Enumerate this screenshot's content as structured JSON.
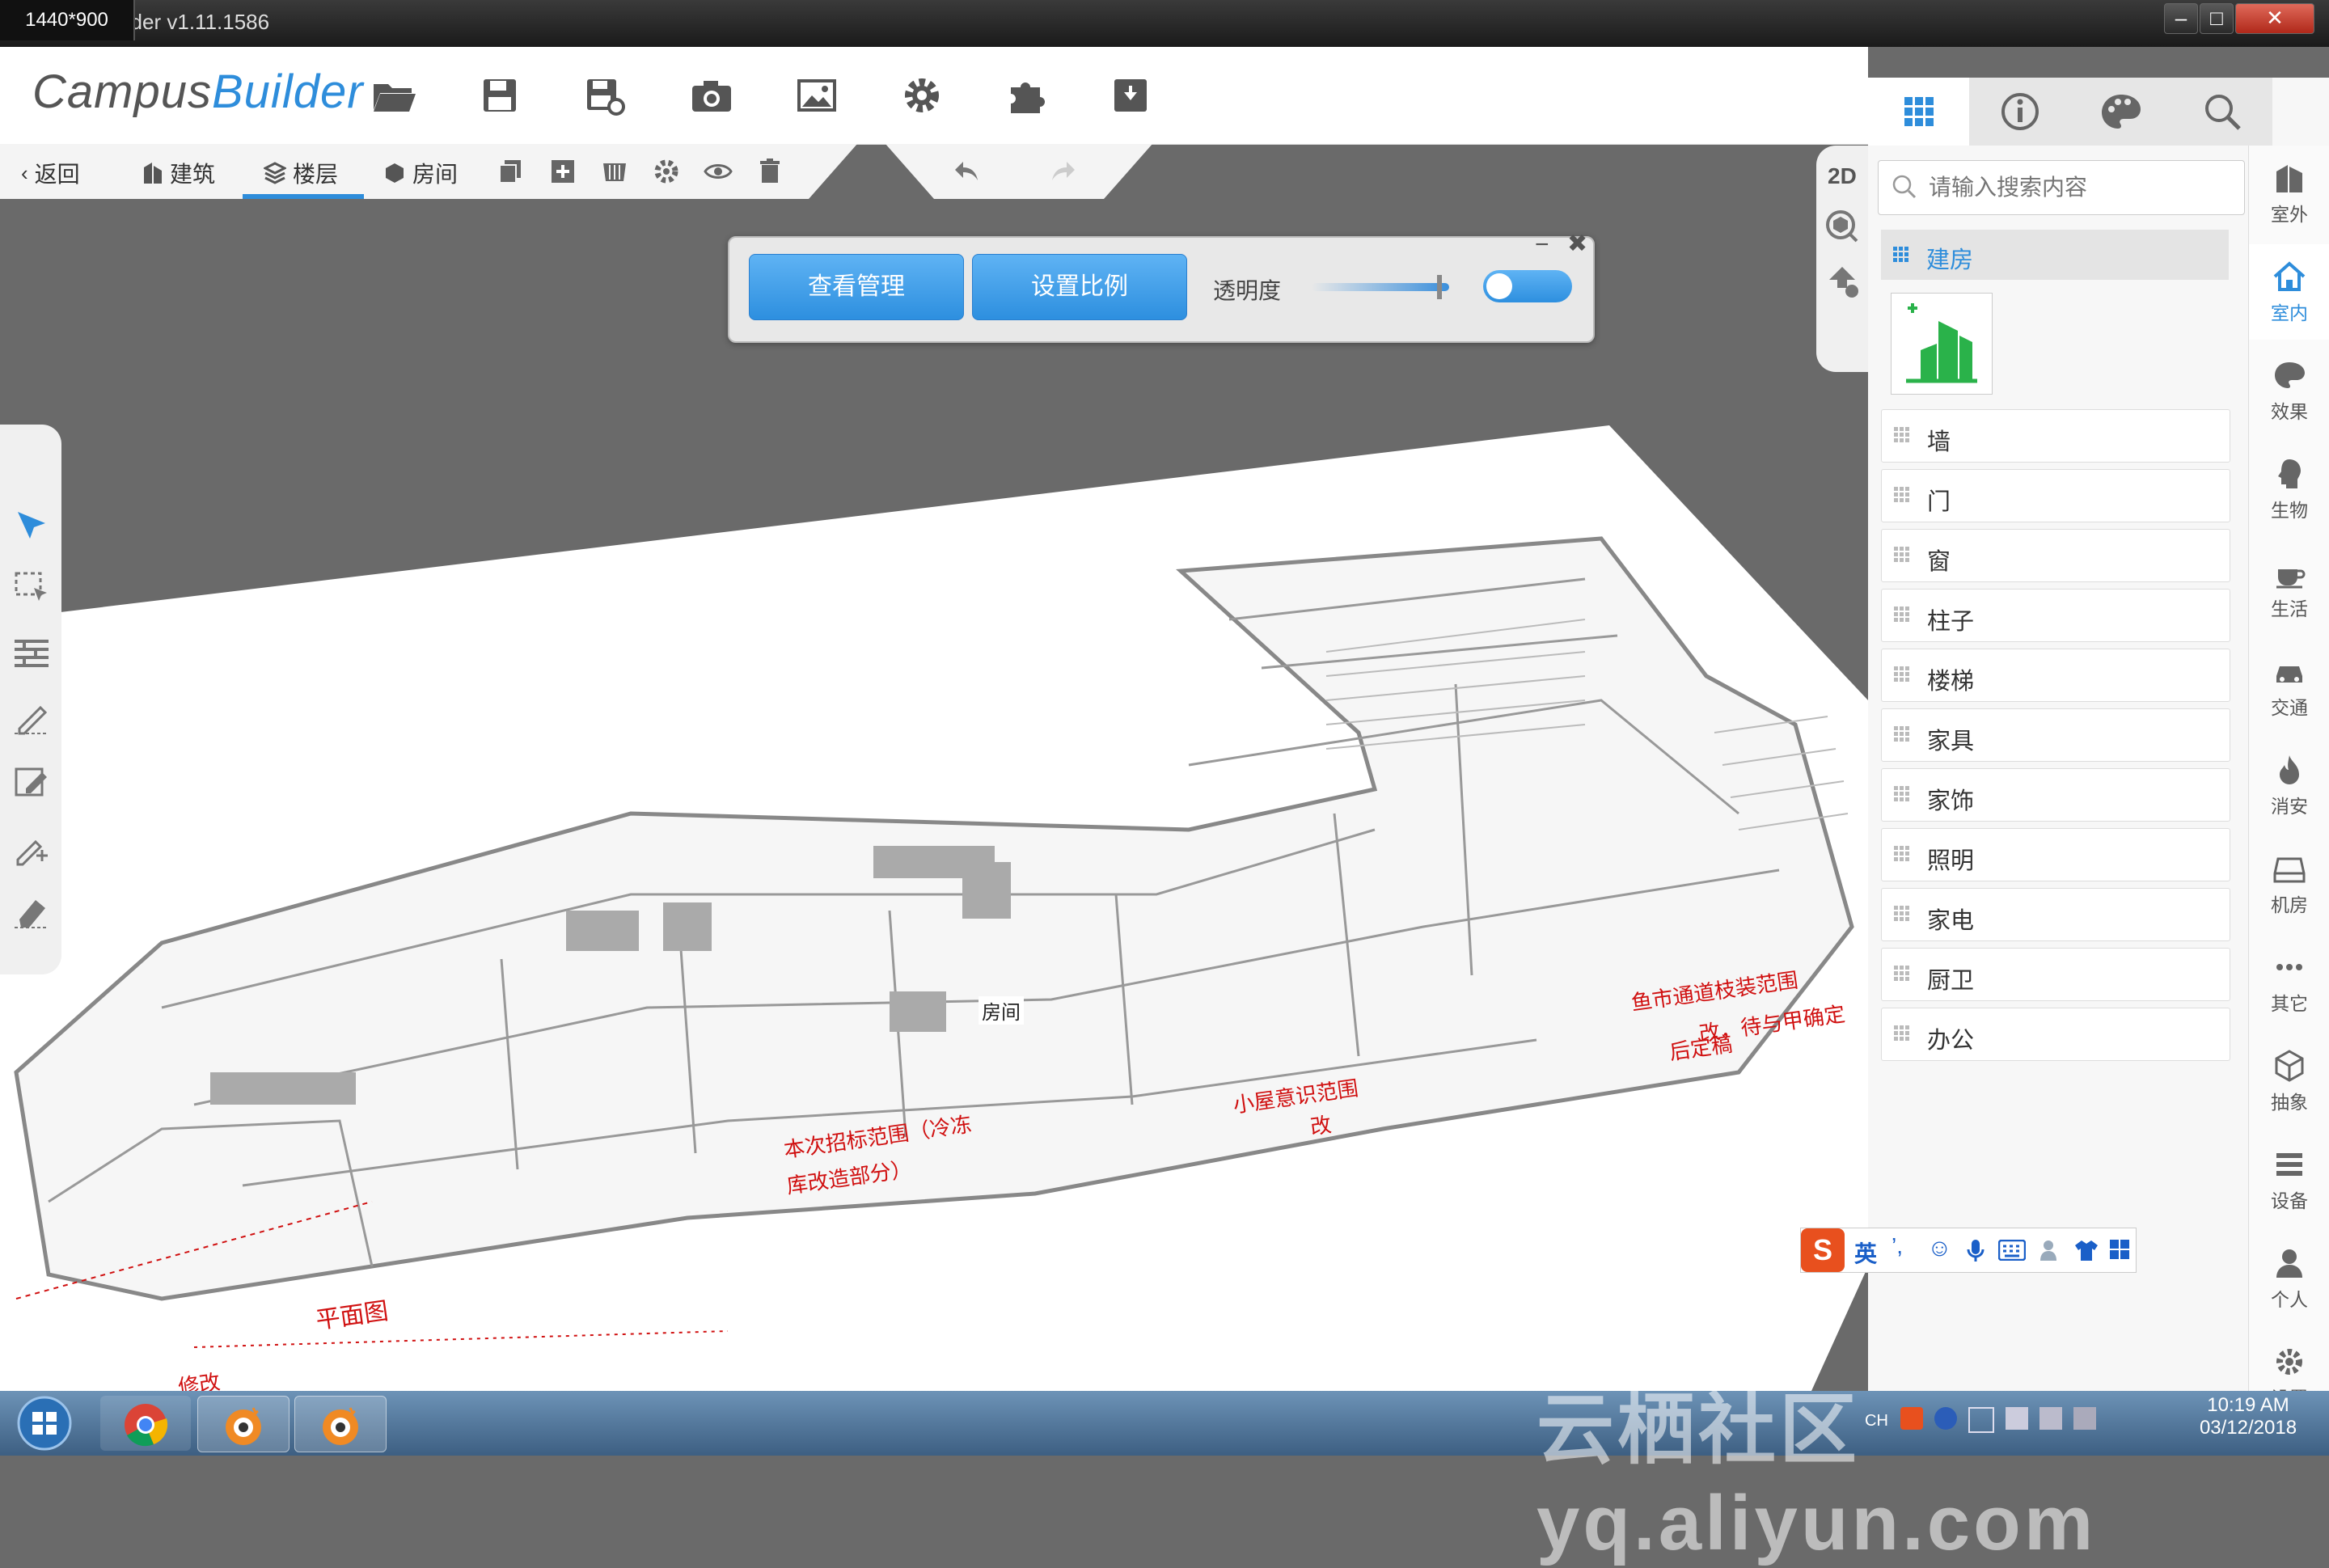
{
  "window": {
    "resolution_badge": "1440*900",
    "title": "ilder v1.11.1586",
    "minimize": "–",
    "maximize": "□",
    "close": "✕"
  },
  "logo": {
    "part1": "Campus",
    "part2": "Builder"
  },
  "toolbar_icons": [
    "folder-open-icon",
    "save-icon",
    "save-as-icon",
    "camera-icon",
    "image-icon",
    "gear-icon",
    "puzzle-icon",
    "archive-icon"
  ],
  "subbar": {
    "back": "返回",
    "building": "建筑",
    "floor": "楼层",
    "room": "房间"
  },
  "view_2d": "2D",
  "float_panel": {
    "view_manage": "查看管理",
    "set_scale": "设置比例",
    "opacity_label": "透明度",
    "opacity": 0.85,
    "toggle_on": false
  },
  "scene_labels": {
    "room": "房间",
    "red1": "本次招标范围（冷冻",
    "red1b": "库改造部分）",
    "red2": "小屋意识范围",
    "red2b": "改",
    "red3": "鱼市通道枝装范围",
    "red3b": "改，待与甲确定",
    "red3c": "后定稿",
    "red4": "平面图",
    "red5": "修改"
  },
  "right_panel": {
    "search_placeholder": "请输入搜索内容",
    "active_category": "建房",
    "categories": [
      "墙",
      "门",
      "窗",
      "柱子",
      "楼梯",
      "家具",
      "家饰",
      "照明",
      "家电",
      "厨卫",
      "办公"
    ]
  },
  "vnav": [
    "室外",
    "室内",
    "效果",
    "生物",
    "生活",
    "交通",
    "消安",
    "机房",
    "其它",
    "抽象",
    "设备",
    "个人",
    "设置"
  ],
  "ime": {
    "lang": "英"
  },
  "taskbar": {
    "time": "10:19 AM",
    "date": "03/12/2018",
    "tray_ch": "CH"
  },
  "watermark": "云栖社区 yq.aliyun.com",
  "colors": {
    "accent": "#2e8ddb",
    "annotation_red": "#d01010"
  }
}
